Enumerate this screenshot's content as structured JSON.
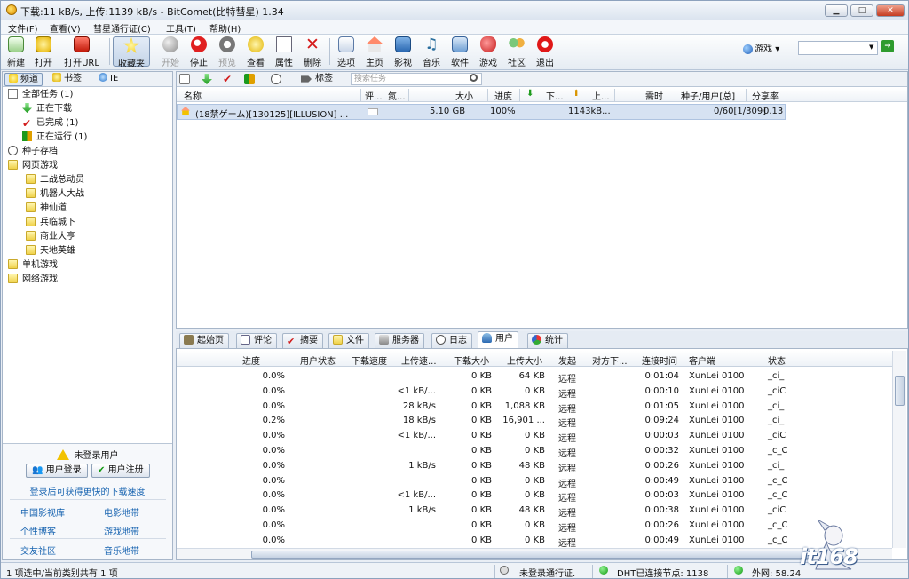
{
  "window": {
    "title": "下载:11 kB/s, 上传:1139 kB/s - BitComet(比特彗星) 1.34",
    "btn_min": "▁",
    "btn_max": "□",
    "btn_close": "✕"
  },
  "menu": [
    "文件(F)",
    "查看(V)",
    "彗星通行证(C)",
    "工具(T)",
    "帮助(H)"
  ],
  "toolbar": {
    "items": [
      "新建",
      "打开",
      "打开URL",
      "收藏夹",
      "开始",
      "停止",
      "预览",
      "查看",
      "属性",
      "删除",
      "选项",
      "主页",
      "影视",
      "音乐",
      "软件",
      "游戏",
      "社区",
      "退出"
    ],
    "dropdown": "游戏",
    "dropdown_arrow": "▾",
    "search_arrow": "▼",
    "go": "➜"
  },
  "colors": {
    "accent": "#1763b0",
    "selection": "#d6e2f2",
    "ok_green": "#129a12"
  },
  "left": {
    "tabs": [
      "频道",
      "书签",
      "IE"
    ],
    "tree": [
      "全部任务 (1)",
      "正在下载",
      "已完成 (1)",
      "正在运行 (1)",
      "种子存档",
      "网页游戏",
      "二战总动员",
      "机器人大战",
      "神仙道",
      "兵临城下",
      "商业大亨",
      "天地英雄",
      "单机游戏",
      "网络游戏"
    ],
    "login_title": "未登录用户",
    "login_btn": "用户登录",
    "register_btn": "用户注册",
    "promo": "登录后可获得更快的下载速度",
    "links": [
      "中国影视库",
      "电影地带",
      "个性博客",
      "游戏地带",
      "交友社区",
      "音乐地带"
    ]
  },
  "tasks": {
    "tag_label": "标签",
    "search_placeholder": "搜索任务",
    "columns": [
      "名称",
      "评...",
      "氮...",
      "大小",
      "进度",
      "下...",
      "上...",
      "需时",
      "种子/用户[总]",
      "分享率"
    ],
    "rows": [
      {
        "name": "(18禁ゲーム)[130125][ILLUSION] ...",
        "size": "5.10 GB",
        "progress": "100%",
        "up": "1143kB...",
        "seeds": "0/60[1/309]",
        "ratio": "0.13"
      }
    ]
  },
  "bottom_tabs": [
    "起始页",
    "评论",
    "摘要",
    "文件",
    "服务器",
    "日志",
    "用户",
    "统计"
  ],
  "peers": {
    "columns": [
      "进度",
      "用户状态",
      "下载速度",
      "上传速...",
      "下载大小",
      "上传大小",
      "发起",
      "对方下...",
      "连接时间",
      "客户端",
      "状态"
    ],
    "rows": [
      [
        "0.0%",
        "",
        "",
        "",
        "0 KB",
        "64 KB",
        "远程",
        "",
        "0:01:04",
        "XunLei 0100",
        "_ci_"
      ],
      [
        "0.0%",
        "",
        "",
        "<1 kB/...",
        "0 KB",
        "0 KB",
        "远程",
        "",
        "0:00:10",
        "XunLei 0100",
        "_ciC"
      ],
      [
        "0.0%",
        "",
        "",
        "28 kB/s",
        "0 KB",
        "1,088 KB",
        "远程",
        "",
        "0:01:05",
        "XunLei 0100",
        "_ci_"
      ],
      [
        "0.2%",
        "",
        "",
        "18 kB/s",
        "0 KB",
        "16,901 ...",
        "远程",
        "",
        "0:09:24",
        "XunLei 0100",
        "_ci_"
      ],
      [
        "0.0%",
        "",
        "",
        "<1 kB/...",
        "0 KB",
        "0 KB",
        "远程",
        "",
        "0:00:03",
        "XunLei 0100",
        "_ciC"
      ],
      [
        "0.0%",
        "",
        "",
        "",
        "0 KB",
        "0 KB",
        "远程",
        "",
        "0:00:32",
        "XunLei 0100",
        "_c_C"
      ],
      [
        "0.0%",
        "",
        "",
        "1 kB/s",
        "0 KB",
        "48 KB",
        "远程",
        "",
        "0:00:26",
        "XunLei 0100",
        "_ci_"
      ],
      [
        "0.0%",
        "",
        "",
        "",
        "0 KB",
        "0 KB",
        "远程",
        "",
        "0:00:49",
        "XunLei 0100",
        "_c_C"
      ],
      [
        "0.0%",
        "",
        "",
        "<1 kB/...",
        "0 KB",
        "0 KB",
        "远程",
        "",
        "0:00:03",
        "XunLei 0100",
        "_c_C"
      ],
      [
        "0.0%",
        "",
        "",
        "1 kB/s",
        "0 KB",
        "48 KB",
        "远程",
        "",
        "0:00:38",
        "XunLei 0100",
        "_ciC"
      ],
      [
        "0.0%",
        "",
        "",
        "",
        "0 KB",
        "0 KB",
        "远程",
        "",
        "0:00:26",
        "XunLei 0100",
        "_c_C"
      ],
      [
        "0.0%",
        "",
        "",
        "",
        "0 KB",
        "0 KB",
        "远程",
        "",
        "0:00:49",
        "XunLei 0100",
        "_c_C"
      ]
    ]
  },
  "status": {
    "selection": "1 项选中/当前类别共有 1 项",
    "passport": "未登录通行证.",
    "dht": "DHT已连接节点: 1138",
    "ip": "外网: 58.24"
  },
  "watermark": "it168"
}
